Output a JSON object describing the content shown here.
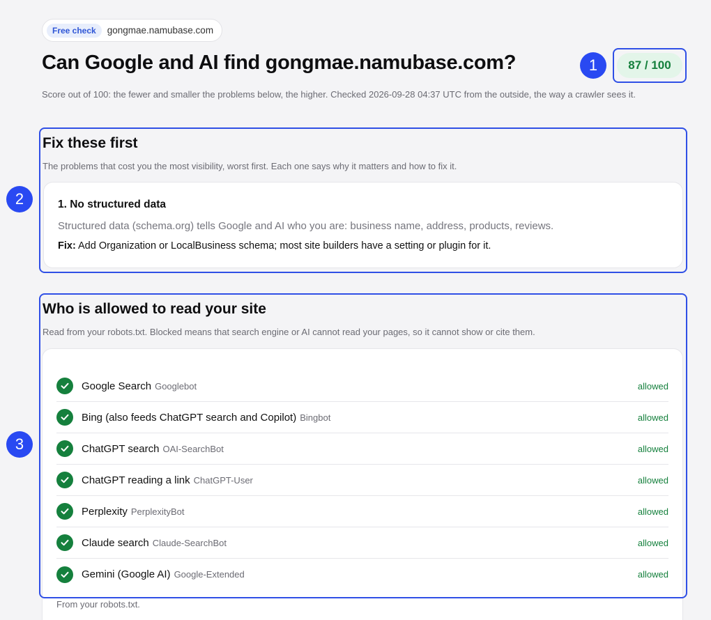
{
  "header": {
    "badge": "Free check",
    "host": "gongmae.namubase.com",
    "title": "Can Google and AI find gongmae.namubase.com?",
    "score": "87 / 100",
    "subtitle": "Score out of 100: the fewer and smaller the problems below, the higher. Checked 2026-09-28 04:37 UTC from the outside, the way a crawler sees it."
  },
  "markers": [
    "1",
    "2",
    "3"
  ],
  "fix_section": {
    "title": "Fix these first",
    "description": "The problems that cost you the most visibility, worst first. Each one says why it matters and how to fix it.",
    "issues": [
      {
        "title": "1. No structured data",
        "why": "Structured data (schema.org) tells Google and AI who you are: business name, address, products, reviews.",
        "fix_label": "Fix:",
        "fix_text": "Add Organization or LocalBusiness schema; most site builders have a setting or plugin for it."
      }
    ]
  },
  "crawler_section": {
    "title": "Who is allowed to read your site",
    "description": "Read from your robots.txt. Blocked means that search engine or AI cannot read your pages, so it cannot show or cite them.",
    "crawlers": [
      {
        "name": "Google Search",
        "agent": "Googlebot",
        "status": "allowed"
      },
      {
        "name": "Bing (also feeds ChatGPT search and Copilot)",
        "agent": "Bingbot",
        "status": "allowed"
      },
      {
        "name": "ChatGPT search",
        "agent": "OAI-SearchBot",
        "status": "allowed"
      },
      {
        "name": "ChatGPT reading a link",
        "agent": "ChatGPT-User",
        "status": "allowed"
      },
      {
        "name": "Perplexity",
        "agent": "PerplexityBot",
        "status": "allowed"
      },
      {
        "name": "Claude search",
        "agent": "Claude-SearchBot",
        "status": "allowed"
      },
      {
        "name": "Gemini (Google AI)",
        "agent": "Google-Extended",
        "status": "allowed"
      }
    ],
    "footnote": "From your robots.txt."
  },
  "colors": {
    "accent": "#2f4fe6",
    "marker": "#2949f2",
    "success": "#15803d",
    "score_bg": "#e3f5e9"
  },
  "icons": [
    "check-circle-icon"
  ]
}
